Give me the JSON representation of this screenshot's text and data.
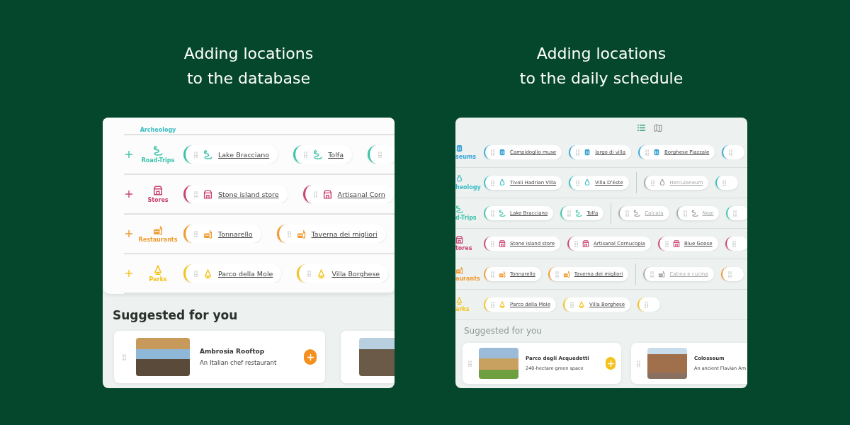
{
  "slides": [
    {
      "heading": "Adding locations\nto the database",
      "kind": "database",
      "categories": [
        {
          "label": "Archeology",
          "color": "#3bbcc4"
        },
        {
          "label": "Road-Trips",
          "kind": "road-trip",
          "color": "#3cc3aa",
          "chips": [
            {
              "name": "Lake Bracciano",
              "active": true
            },
            {
              "name": "Tolfa",
              "active": true
            }
          ]
        },
        {
          "label": "Stores",
          "kind": "store",
          "color": "#c9446e",
          "chips": [
            {
              "name": "Stone island store",
              "active": true
            },
            {
              "name": "Artisanal Corn",
              "active": true
            }
          ]
        },
        {
          "label": "Restaurants",
          "kind": "restaurant",
          "color": "#f09a2e",
          "chips": [
            {
              "name": "Tonnarello",
              "active": true
            },
            {
              "name": "Taverna dei migliori",
              "active": true
            }
          ]
        },
        {
          "label": "Parks",
          "kind": "park",
          "color": "#f4c21c",
          "chips": [
            {
              "name": "Parco della Mole",
              "active": true
            },
            {
              "name": "Villa Borghese",
              "active": true
            }
          ]
        }
      ],
      "suggested_heading": "Suggested for you",
      "cards": [
        {
          "kind": "full",
          "title": "Ambrosia Rooftop",
          "subtitle": "An Italian chef restaurant",
          "color": "#f5901e"
        },
        {
          "kind": "photo-only"
        }
      ]
    },
    {
      "heading": "Adding locations\nto the daily schedule",
      "kind": "schedule",
      "categories": [
        {
          "label": "seums",
          "kind": "museum",
          "color": "#3aa4d8",
          "chips": [
            {
              "name": "Campidoglio muse",
              "active": true
            },
            {
              "name": "largo di villa",
              "active": true
            },
            {
              "name": "Borghese Piazzale",
              "active": true
            }
          ]
        },
        {
          "label": "heology",
          "kind": "archeology",
          "color": "#3bbcc4",
          "chips": [
            {
              "name": "Tivoli Hadrian Villa",
              "active": true
            },
            {
              "name": "Villa D'Este",
              "active": true
            },
            {
              "name": "Herculaneum",
              "active": false
            }
          ]
        },
        {
          "label": "d-Trips",
          "kind": "road-trip",
          "color": "#3cc3aa",
          "chips": [
            {
              "name": "Lake Bracciano",
              "active": true
            },
            {
              "name": "Tolfa",
              "active": true
            },
            {
              "name": "Calcata",
              "active": false
            },
            {
              "name": "Nepi",
              "active": false
            }
          ]
        },
        {
          "label": "tores",
          "kind": "store",
          "color": "#c9446e",
          "chips": [
            {
              "name": "Stone island store",
              "active": true
            },
            {
              "name": "Artisanal Cornucopia",
              "active": true
            },
            {
              "name": "Blue Goose",
              "active": true
            }
          ]
        },
        {
          "label": "aurants",
          "kind": "restaurant",
          "color": "#f09a2e",
          "chips": [
            {
              "name": "Tonnarello",
              "active": true
            },
            {
              "name": "Taverna dei migliori",
              "active": true
            },
            {
              "name": "Catina e cucina",
              "active": false
            }
          ]
        },
        {
          "label": "arks",
          "kind": "park",
          "color": "#f4c21c",
          "chips": [
            {
              "name": "Parco della Mole",
              "active": true
            },
            {
              "name": "Villa Borghese",
              "active": true
            }
          ]
        }
      ],
      "suggested_heading": "Suggested for you",
      "cards": [
        {
          "kind": "full",
          "title": "Parco degli Acquedotti",
          "subtitle": "240-hectare green space",
          "color": "#f4c21c"
        },
        {
          "kind": "full",
          "title": "Colosseum",
          "subtitle": "An ancient Flavian Am"
        }
      ]
    }
  ]
}
